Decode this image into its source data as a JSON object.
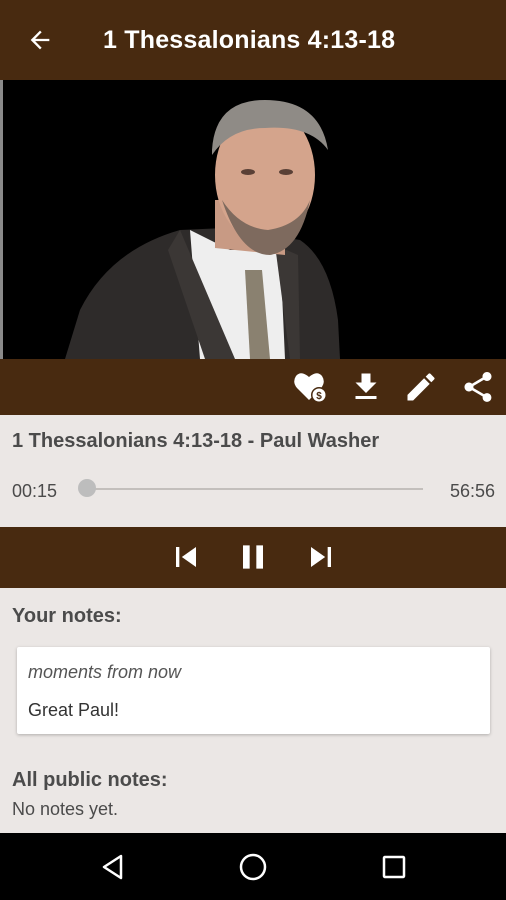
{
  "app_bar": {
    "title": "1 Thessalonians 4:13-18",
    "back_icon": "arrow-back-icon"
  },
  "video": {
    "description": "Video player frame"
  },
  "actions": [
    "donate-heart-icon",
    "download-icon",
    "edit-icon",
    "share-icon"
  ],
  "player": {
    "track_title": "1 Thessalonians 4:13-18 - Paul Washer",
    "current_time": "00:15",
    "total_time": "56:56",
    "progress": 0.004
  },
  "controls": [
    "skip-previous-icon",
    "pause-icon",
    "skip-next-icon"
  ],
  "notes": {
    "your_notes_label": "Your notes:",
    "user_note": {
      "time": "moments from now",
      "text": "Great Paul!"
    },
    "public_label": "All public notes:",
    "public_empty": "No notes yet."
  },
  "system_nav": [
    "back-triangle-icon",
    "home-circle-icon",
    "recents-square-icon"
  ],
  "colors": {
    "brand_brown": "#482a10",
    "background": "#ebe7e5"
  }
}
